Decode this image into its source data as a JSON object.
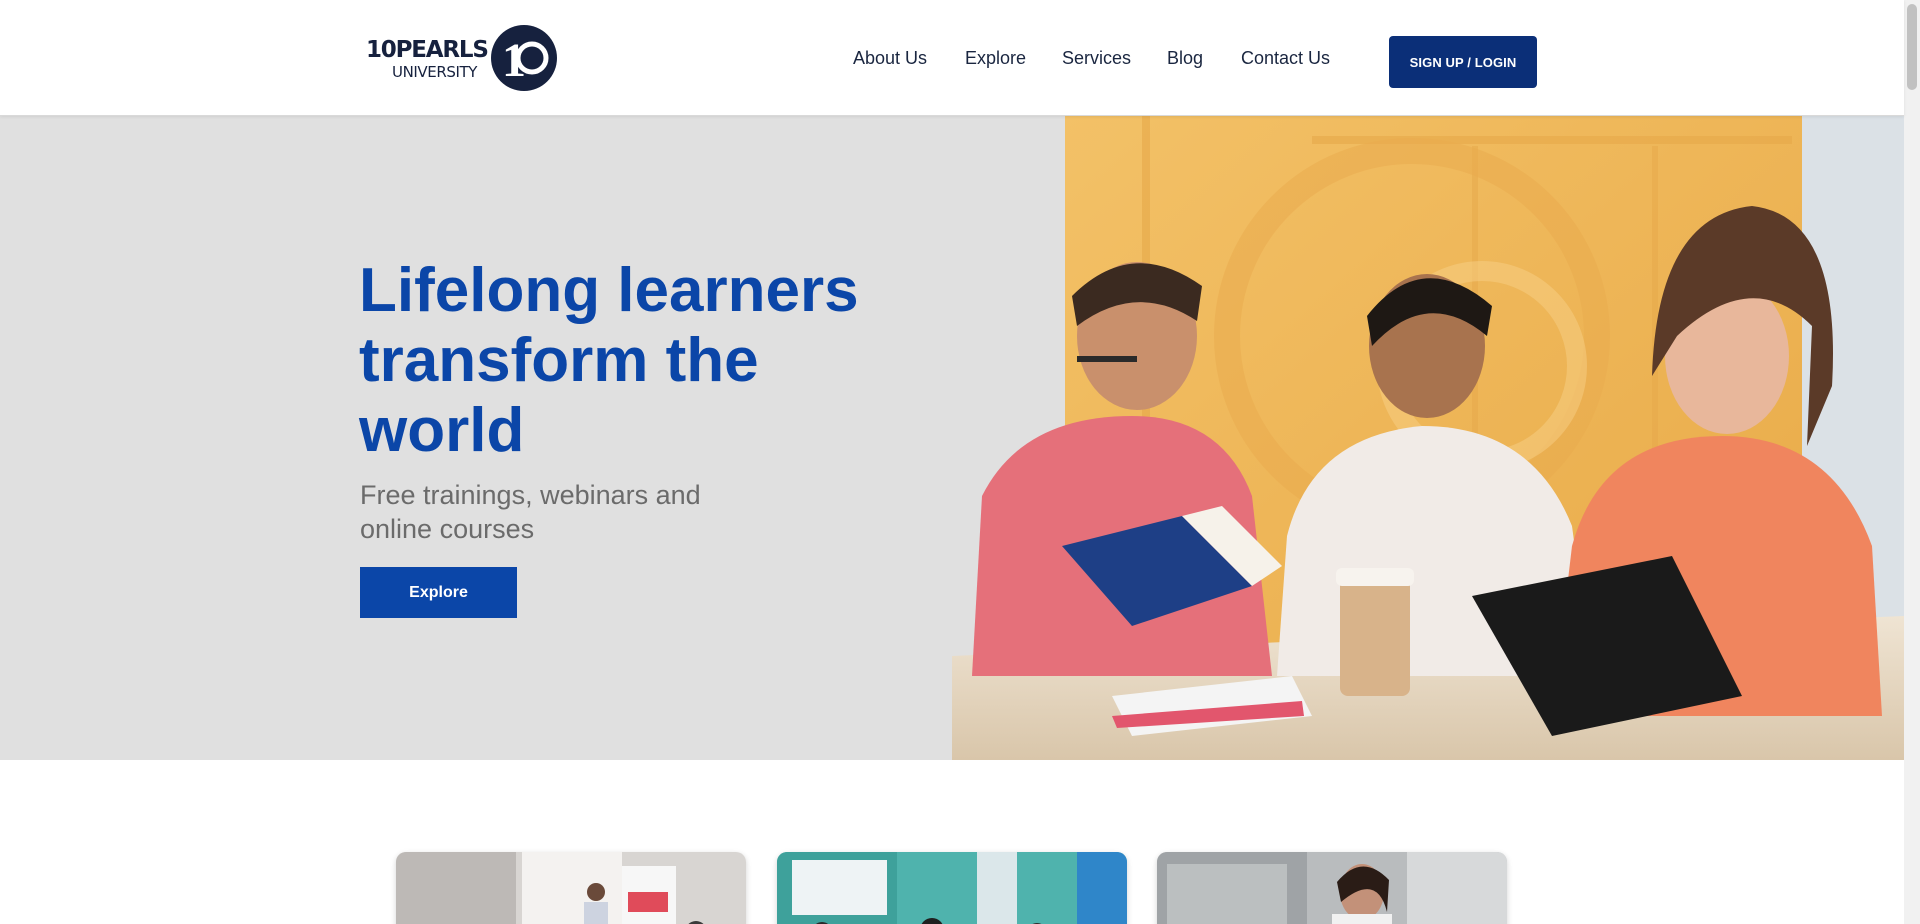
{
  "header": {
    "logo": {
      "line1": "10PEARLS",
      "line2": "UNIVERSITY",
      "mark": "10"
    },
    "nav": [
      "About Us",
      "Explore",
      "Services",
      "Blog",
      "Contact Us"
    ],
    "signup_label": "SIGN UP / LOGIN"
  },
  "hero": {
    "title": "Lifelong learners transform the world",
    "subtitle": "Free trainings, webinars and online courses",
    "cta_label": "Explore"
  },
  "colors": {
    "brand_blue": "#0b46a8",
    "navy": "#0b2f78",
    "hero_bg": "#e0e0e0",
    "accent_yellow": "#f2b84b"
  },
  "icons": {
    "logo_mark": "10-ring-logo"
  }
}
